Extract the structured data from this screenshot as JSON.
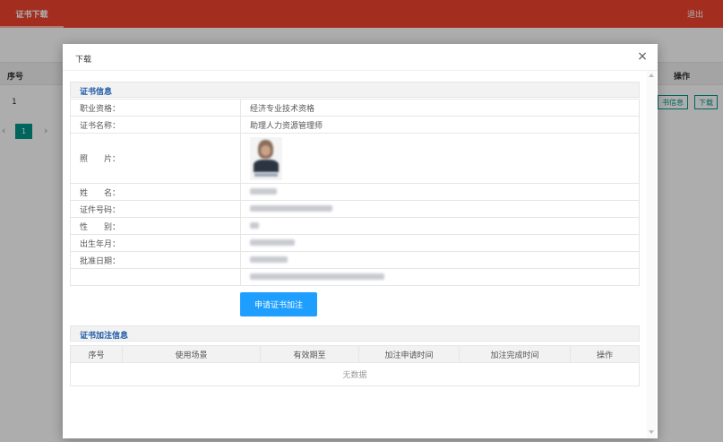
{
  "topbar": {
    "nav_title": "证书下载",
    "logout": "退出"
  },
  "background_page": {
    "table_header": {
      "seq": "序号",
      "op": "操作"
    },
    "row": {
      "seq": "1",
      "info_button": "书信息",
      "download_button": "下载"
    },
    "pager": {
      "current_page": "1",
      "prev": "‹",
      "next": "›"
    }
  },
  "modal": {
    "title": "下载",
    "close": "×",
    "cert_section": {
      "title": "证书信息",
      "rows": [
        {
          "label": "职业资格：",
          "value": "经济专业技术资格"
        },
        {
          "label": "证书名称：",
          "value": "助理人力资源管理师"
        },
        {
          "label": "照　　片：",
          "value": ""
        },
        {
          "label": "姓　　名：",
          "value": ""
        },
        {
          "label": "证件号码：",
          "value": ""
        },
        {
          "label": "性　　别：",
          "value": ""
        },
        {
          "label": "出生年月：",
          "value": ""
        },
        {
          "label": "批准日期：",
          "value": ""
        },
        {
          "label": "",
          "value": ""
        }
      ]
    },
    "apply_button": "申请证书加注",
    "annotation_section": {
      "title": "证书加注信息",
      "columns": [
        "序号",
        "使用场景",
        "有效期至",
        "加注申请时间",
        "加注完成时间",
        "操作"
      ],
      "empty_text": "无数据"
    }
  }
}
